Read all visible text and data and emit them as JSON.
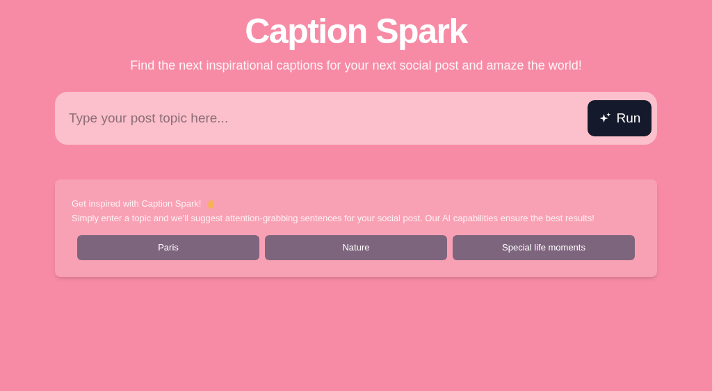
{
  "header": {
    "title": "Caption Spark",
    "subtitle": "Find the next inspirational captions for your next social post and amaze the world!"
  },
  "search": {
    "placeholder": "Type your post topic here...",
    "button": "Run"
  },
  "intro": {
    "heading": "Get inspired with Caption Spark!",
    "text": "Simply enter a topic and we'll suggest attention-grabbing sentences for your social post. Our AI capabilities ensure the best results!"
  },
  "suggestions": [
    "Paris",
    "Nature",
    "Special life moments"
  ]
}
